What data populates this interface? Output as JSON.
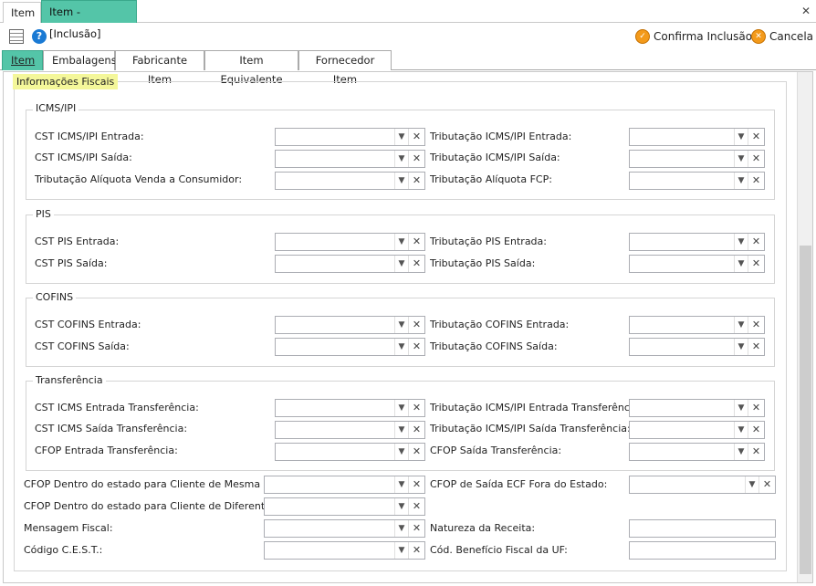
{
  "doc_tabs": [
    "Item",
    "Item - [Inclusão]"
  ],
  "toolbar": {
    "confirm_label": "Confirma Inclusão",
    "cancel_label": "Cancela"
  },
  "page_tabs": [
    "Item",
    "Embalagens",
    "Fabricante Item",
    "Item Equivalente",
    "Fornecedor Item"
  ],
  "section_title": "Informações Fiscais",
  "groups": {
    "icms": {
      "title": "ICMS/IPI",
      "left": [
        "CST ICMS/IPI Entrada:",
        "CST ICMS/IPI Saída:",
        "Tributação Alíquota Venda a Consumidor:"
      ],
      "right": [
        "Tributação ICMS/IPI Entrada:",
        "Tributação ICMS/IPI Saída:",
        "Tributação Alíquota FCP:"
      ]
    },
    "pis": {
      "title": "PIS",
      "left": [
        "CST PIS Entrada:",
        "CST PIS Saída:"
      ],
      "right": [
        "Tributação PIS Entrada:",
        "Tributação PIS Saída:"
      ]
    },
    "cofins": {
      "title": "COFINS",
      "left": [
        "CST COFINS Entrada:",
        "CST COFINS Saída:"
      ],
      "right": [
        "Tributação COFINS Entrada:",
        "Tributação COFINS Saída:"
      ]
    },
    "transf": {
      "title": "Transferência",
      "left": [
        "CST ICMS Entrada Transferência:",
        "CST ICMS Saída Transferência:",
        "CFOP Entrada Transferência:"
      ],
      "right": [
        "Tributação ICMS/IPI Entrada Transferência:",
        "Tributação ICMS/IPI Saída Transferência:",
        "CFOP Saída Transferência:"
      ]
    }
  },
  "bottom": {
    "cfop_mesma_uf": "CFOP Dentro do estado para Cliente de Mesma UF:",
    "cfop_diferente_uf": "CFOP Dentro do estado para Cliente de Diferente UF:",
    "mensagem_fiscal": "Mensagem Fiscal:",
    "cest": "Código C.E.S.T.:",
    "cfop_ecf": "CFOP de Saída ECF Fora do Estado:",
    "natureza_receita": "Natureza da Receita:",
    "beneficio_fiscal": "Cód. Benefício Fiscal da UF:"
  }
}
